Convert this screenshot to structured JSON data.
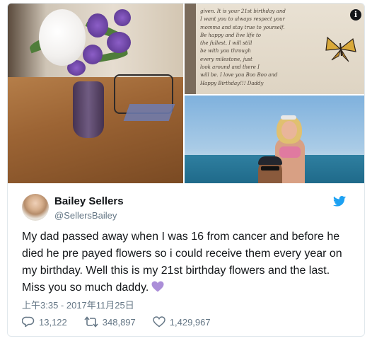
{
  "media": {
    "note_lines": [
      "given. It is your 21st birthday and",
      "I want you to always respect your",
      "momma and stay true to yourself.",
      "Be happy and live life to",
      "the fullest. I will still",
      "be with you through",
      "every milestone, just",
      "look around and there I",
      "will be. I love you Boo Boo and",
      "Happy Birthday!!! Daddy"
    ],
    "info_icon": "i"
  },
  "author": {
    "display_name": "Bailey Sellers",
    "handle": "@SellersBailey"
  },
  "tweet": {
    "text": "My dad passed away when I was 16 from cancer and before he died he pre payed flowers so i could receive them every year on my birthday. Well this is my 21st birthday flowers and the last. Miss you so much daddy.",
    "emoji": "purple-heart",
    "timestamp": "上午3:35 - 2017年11月25日"
  },
  "actions": {
    "replies": "13,122",
    "retweets": "348,897",
    "likes": "1,429,967"
  },
  "colors": {
    "brand_blue": "#1da1f2",
    "purple_heart": "#ab8ed8",
    "muted_text": "#657786",
    "border": "#e1e8ed"
  }
}
